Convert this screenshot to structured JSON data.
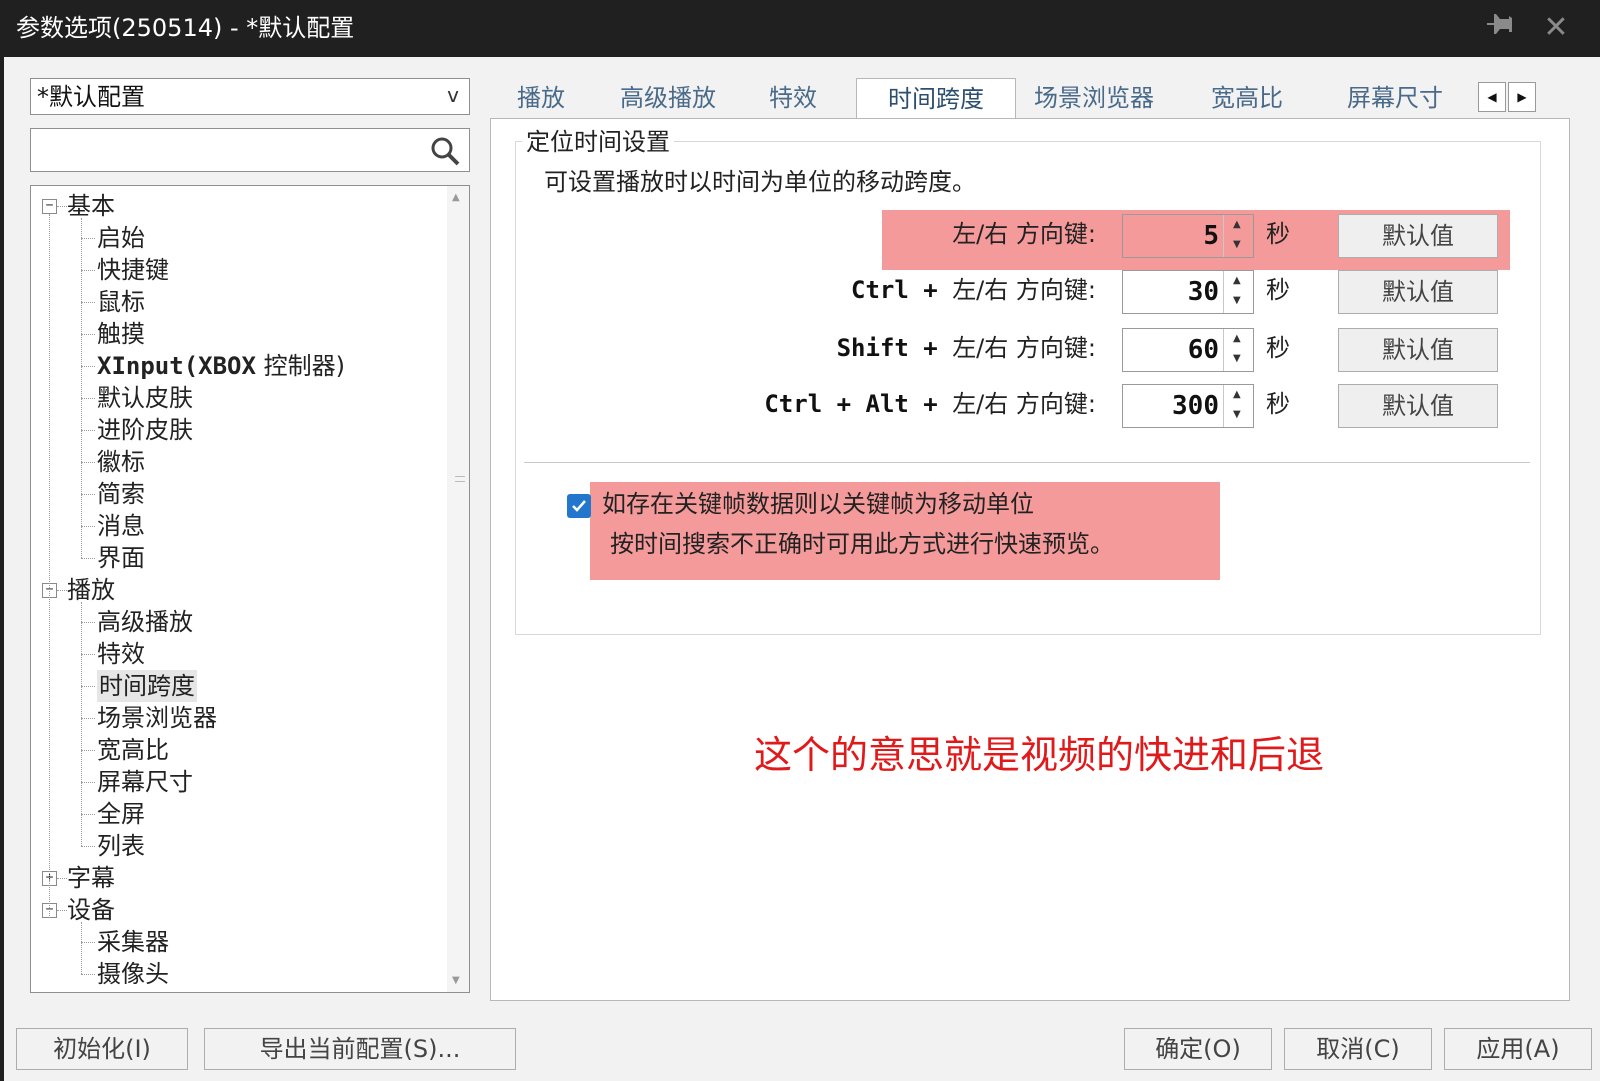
{
  "window": {
    "title": "参数选项(250514) - *默认配置"
  },
  "profile": {
    "selected": "*默认配置",
    "arrow": "v"
  },
  "search": {
    "value": ""
  },
  "tree": [
    {
      "id": "basic",
      "label": "基本",
      "level": 0,
      "toggle": "−"
    },
    {
      "id": "start",
      "label": "启始",
      "level": 1
    },
    {
      "id": "hotkey",
      "label": "快捷键",
      "level": 1
    },
    {
      "id": "mouse",
      "label": "鼠标",
      "level": 1
    },
    {
      "id": "touch",
      "label": "触摸",
      "level": 1
    },
    {
      "id": "xinput",
      "label_bold": "XInput(XBOX",
      "label_rest": " 控制器)",
      "level": 1
    },
    {
      "id": "default-skin",
      "label": "默认皮肤",
      "level": 1
    },
    {
      "id": "adv-skin",
      "label": "进阶皮肤",
      "level": 1
    },
    {
      "id": "logo",
      "label": "徽标",
      "level": 1
    },
    {
      "id": "index",
      "label": "简索",
      "level": 1
    },
    {
      "id": "message",
      "label": "消息",
      "level": 1
    },
    {
      "id": "interface",
      "label": "界面",
      "level": 1
    },
    {
      "id": "playback",
      "label": "播放",
      "level": 0,
      "toggle": "−"
    },
    {
      "id": "adv-playback",
      "label": "高级播放",
      "level": 1
    },
    {
      "id": "effects",
      "label": "特效",
      "level": 1
    },
    {
      "id": "time-span",
      "label": "时间跨度",
      "level": 1,
      "selected": true
    },
    {
      "id": "scene-browser",
      "label": "场景浏览器",
      "level": 1
    },
    {
      "id": "aspect",
      "label": "宽高比",
      "level": 1
    },
    {
      "id": "screen-size",
      "label": "屏幕尺寸",
      "level": 1
    },
    {
      "id": "fullscreen",
      "label": "全屏",
      "level": 1
    },
    {
      "id": "list",
      "label": "列表",
      "level": 1
    },
    {
      "id": "subtitle",
      "label": "字幕",
      "level": 0,
      "toggle": "+"
    },
    {
      "id": "device",
      "label": "设备",
      "level": 0,
      "toggle": "−"
    },
    {
      "id": "capture",
      "label": "采集器",
      "level": 1
    },
    {
      "id": "camera",
      "label": "摄像头",
      "level": 1
    }
  ],
  "tabs": [
    {
      "label": "播放"
    },
    {
      "label": "高级播放"
    },
    {
      "label": "特效"
    },
    {
      "label": "时间跨度",
      "active": true
    },
    {
      "label": "场景浏览器"
    },
    {
      "label": "宽高比"
    },
    {
      "label": "屏幕尺寸"
    }
  ],
  "panel": {
    "group_title": "定位时间设置",
    "description": "可设置播放时以时间为单位的移动跨度。",
    "unit": "秒",
    "default_label": "默认值",
    "rows": [
      {
        "prefix": "",
        "label": "左/右 方向键:",
        "value": "5",
        "highlighted": true
      },
      {
        "prefix": "Ctrl + ",
        "label": "左/右 方向键:",
        "value": "30"
      },
      {
        "prefix": "Shift + ",
        "label": "左/右 方向键:",
        "value": "60"
      },
      {
        "prefix": "Ctrl + Alt + ",
        "label": "左/右 方向键:",
        "value": "300"
      }
    ],
    "keyframe": {
      "checked": true,
      "line1": "如存在关键帧数据则以关键帧为移动单位",
      "line2": "按时间搜索不正确时可用此方式进行快速预览。"
    }
  },
  "annotation": "这个的意思就是视频的快进和后退",
  "buttons": {
    "init": "初始化(I)",
    "export": "导出当前配置(S)...",
    "ok": "确定(O)",
    "cancel": "取消(C)",
    "apply": "应用(A)"
  },
  "colors": {
    "highlight": "#f59a9a",
    "annotation": "#e0191b",
    "checkbox": "#2277cc",
    "tab_text": "#4a6a8a"
  }
}
